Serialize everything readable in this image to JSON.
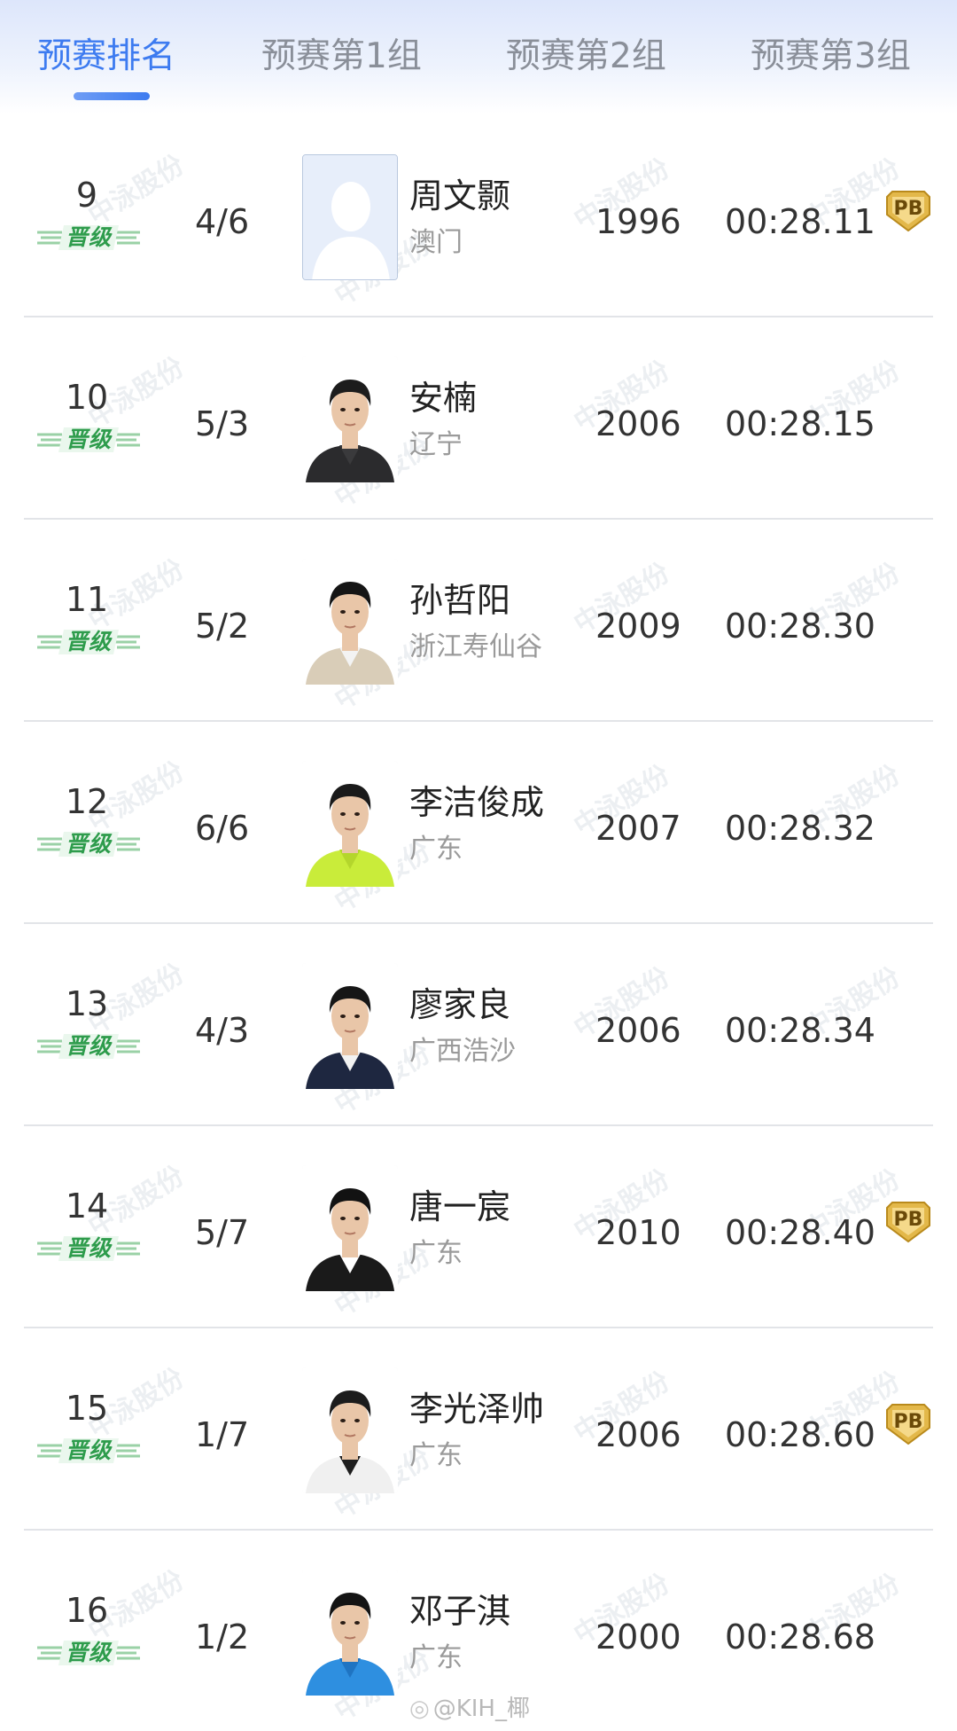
{
  "tabs": [
    {
      "label": "预赛排名",
      "active": true
    },
    {
      "label": "预赛第1组",
      "active": false
    },
    {
      "label": "预赛第2组",
      "active": false
    },
    {
      "label": "预赛第3组",
      "active": false
    }
  ],
  "qualified_label": "晋级",
  "pb_label": "PB",
  "watermark_text": "中泳股份",
  "rows": [
    {
      "rank": "9",
      "lane": "4/6",
      "name": "周文颢",
      "team": "澳门",
      "year": "1996",
      "time": "00:28.11",
      "pb": true,
      "photo": "placeholder"
    },
    {
      "rank": "10",
      "lane": "5/3",
      "name": "安楠",
      "team": "辽宁",
      "year": "2006",
      "time": "00:28.15",
      "pb": false,
      "photo": "dark-hoodie"
    },
    {
      "rank": "11",
      "lane": "5/2",
      "name": "孙哲阳",
      "team": "浙江寿仙谷",
      "year": "2009",
      "time": "00:28.30",
      "pb": false,
      "photo": "beige-jacket"
    },
    {
      "rank": "12",
      "lane": "6/6",
      "name": "李洁俊成",
      "team": "广东",
      "year": "2007",
      "time": "00:28.32",
      "pb": false,
      "photo": "lime-shirt"
    },
    {
      "rank": "13",
      "lane": "4/3",
      "name": "廖家良",
      "team": "广西浩沙",
      "year": "2006",
      "time": "00:28.34",
      "pb": false,
      "photo": "navy-shirt"
    },
    {
      "rank": "14",
      "lane": "5/7",
      "name": "唐一宸",
      "team": "广东",
      "year": "2010",
      "time": "00:28.40",
      "pb": true,
      "photo": "black-suit"
    },
    {
      "rank": "15",
      "lane": "1/7",
      "name": "李光泽帅",
      "team": "广东",
      "year": "2006",
      "time": "00:28.60",
      "pb": true,
      "photo": "white-shirt"
    },
    {
      "rank": "16",
      "lane": "1/2",
      "name": "邓子淇",
      "team": "广东",
      "year": "2000",
      "time": "00:28.68",
      "pb": false,
      "photo": "blue-shirt"
    }
  ],
  "colors": {
    "accent": "#3d7bf0",
    "qualified_green": "#2e9c4c",
    "pb_gold": "#e3b84a"
  },
  "credit": "@KIH_椰"
}
